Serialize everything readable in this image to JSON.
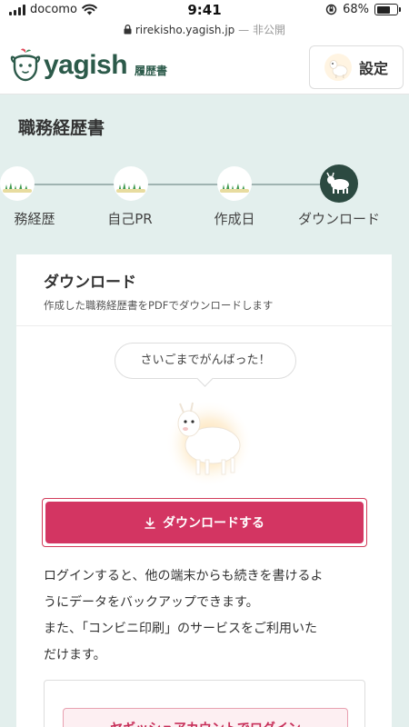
{
  "status_bar": {
    "carrier": "docomo",
    "time": "9:41",
    "battery": "68%",
    "battery_level": 0.68,
    "url": "rirekisho.yagish.jp",
    "url_suffix": "— 非公開"
  },
  "header": {
    "logo_text": "yagish",
    "logo_sub": "履歴書",
    "settings_label": "設定"
  },
  "page_title": "職務経歴書",
  "steps": [
    {
      "label": "務経歴",
      "active": false
    },
    {
      "label": "自己PR",
      "active": false
    },
    {
      "label": "作成日",
      "active": false
    },
    {
      "label": "ダウンロード",
      "active": true
    }
  ],
  "card": {
    "title": "ダウンロード",
    "subtitle": "作成した職務経歴書をPDFでダウンロードします",
    "bubble": "さいごまでがんばった！",
    "download_label": "ダウンロードする",
    "description_lines": [
      "ログインすると、他の端末からも続きを書けるよ",
      "うにデータをバックアップできます。",
      "また、「コンビニ印刷」のサービスをご利用いた",
      "だけます。"
    ],
    "login_label": "ヤギッシュアカウントでログイン"
  },
  "colors": {
    "brand_green": "#2c5a4a",
    "accent_pink": "#d33562",
    "background": "#e3efed"
  },
  "icons": [
    "wifi-icon",
    "lock-icon",
    "orientation-lock-icon",
    "battery-icon",
    "goat-logo-icon",
    "goat-avatar-icon",
    "grass-icon",
    "goat-icon",
    "download-icon"
  ]
}
